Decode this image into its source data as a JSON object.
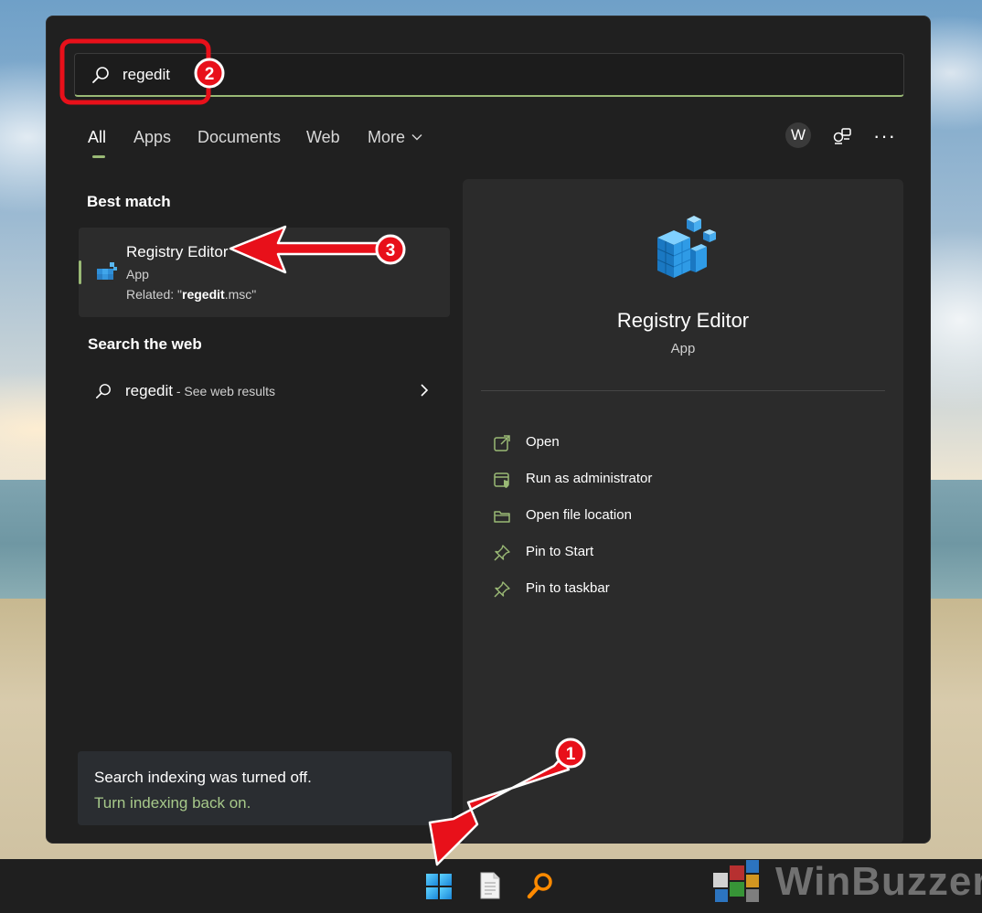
{
  "search": {
    "value": "regedit"
  },
  "tabs": [
    {
      "label": "All"
    },
    {
      "label": "Apps"
    },
    {
      "label": "Documents"
    },
    {
      "label": "Web"
    },
    {
      "label": "More"
    }
  ],
  "account_initial": "W",
  "best_match": {
    "heading": "Best match",
    "title": "Registry Editor",
    "type": "App",
    "related_prefix": "Related: \"",
    "related_bold": "regedit",
    "related_suffix": ".msc\""
  },
  "web": {
    "heading": "Search the web",
    "query": "regedit",
    "suffix": " - See web results"
  },
  "index_notice": {
    "text": "Search indexing was turned off.",
    "link": "Turn indexing back on."
  },
  "preview": {
    "title": "Registry Editor",
    "type": "App",
    "actions": [
      {
        "label": "Open",
        "icon": "open-external-icon"
      },
      {
        "label": "Run as administrator",
        "icon": "run-as-admin-icon"
      },
      {
        "label": "Open file location",
        "icon": "folder-icon"
      },
      {
        "label": "Pin to Start",
        "icon": "pin-icon"
      },
      {
        "label": "Pin to taskbar",
        "icon": "pin-icon"
      }
    ]
  },
  "annotations": [
    "1",
    "2",
    "3"
  ],
  "watermark": "WinBuzzer",
  "colors": {
    "accent_green": "#9ab975",
    "link_green": "#a7c98a",
    "annotation_red": "#e8101a",
    "panel_bg": "#202020"
  }
}
